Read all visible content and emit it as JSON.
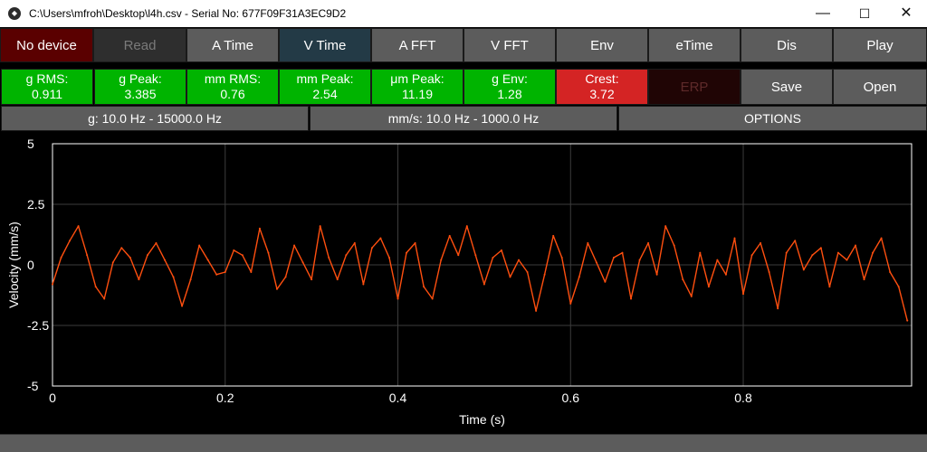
{
  "window": {
    "title": "C:\\Users\\mfroh\\Desktop\\l4h.csv - Serial No: 677F09F31A3EC9D2",
    "icon": "app-logo-icon",
    "minimize": "—",
    "maximize": "☐",
    "close": "✕"
  },
  "toolbar": {
    "no_device": "No device",
    "read": "Read",
    "a_time": "A Time",
    "v_time": "V Time",
    "a_fft": "A FFT",
    "v_fft": "V FFT",
    "env": "Env",
    "etime": "eTime",
    "dis": "Dis",
    "play": "Play"
  },
  "metrics": [
    {
      "label": "g RMS:",
      "value": "0.911"
    },
    {
      "label": "g Peak:",
      "value": "3.385"
    },
    {
      "label": "mm RMS:",
      "value": "0.76"
    },
    {
      "label": "mm Peak:",
      "value": "2.54"
    },
    {
      "label": "μm Peak:",
      "value": "11.19"
    },
    {
      "label": "g Env:",
      "value": "1.28"
    },
    {
      "label": "Crest:",
      "value": "3.72"
    }
  ],
  "actions": {
    "erp": "ERP",
    "save": "Save",
    "open": "Open"
  },
  "filters": {
    "g_range": "g: 10.0 Hz - 15000.0 Hz",
    "mm_range": "mm/s: 10.0 Hz - 1000.0 Hz",
    "options": "OPTIONS"
  },
  "colors": {
    "trace": "#ff4f0f",
    "grid": "#3c3c3c",
    "axes_frame": "#ffffff",
    "ok": "#00b400",
    "alarm": "#d42424"
  },
  "chart_data": {
    "type": "line",
    "xlabel": "Time (s)",
    "ylabel": "Velocity (mm/s)",
    "xlim": [
      0,
      0.995
    ],
    "ylim": [
      -5,
      5
    ],
    "x_ticks": [
      "0",
      "0.2",
      "0.4",
      "0.6",
      "0.8"
    ],
    "y_ticks": [
      "5",
      "2.5",
      "0",
      "-2.5",
      "-5"
    ],
    "x_tick_values": [
      0,
      0.2,
      0.4,
      0.6,
      0.8
    ],
    "y_tick_values": [
      5,
      2.5,
      0,
      -2.5,
      -5
    ],
    "grid": true,
    "series": [
      {
        "x": [
          0,
          0.01,
          0.02,
          0.03,
          0.04,
          0.05,
          0.06,
          0.07,
          0.08,
          0.09,
          0.1,
          0.11,
          0.12,
          0.13,
          0.14,
          0.15,
          0.16,
          0.17,
          0.18,
          0.19,
          0.2,
          0.21,
          0.22,
          0.23,
          0.24,
          0.25,
          0.26,
          0.27,
          0.28,
          0.29,
          0.3,
          0.31,
          0.32,
          0.33,
          0.34,
          0.35,
          0.36,
          0.37,
          0.38,
          0.39,
          0.4,
          0.41,
          0.42,
          0.43,
          0.44,
          0.45,
          0.46,
          0.47,
          0.48,
          0.49,
          0.5,
          0.51,
          0.52,
          0.53,
          0.54,
          0.55,
          0.56,
          0.57,
          0.58,
          0.59,
          0.6,
          0.61,
          0.62,
          0.63,
          0.64,
          0.65,
          0.66,
          0.67,
          0.68,
          0.69,
          0.7,
          0.71,
          0.72,
          0.73,
          0.74,
          0.75,
          0.76,
          0.77,
          0.78,
          0.79,
          0.8,
          0.81,
          0.82,
          0.83,
          0.84,
          0.85,
          0.86,
          0.87,
          0.88,
          0.89,
          0.9,
          0.91,
          0.92,
          0.93,
          0.94,
          0.95,
          0.96,
          0.97,
          0.98,
          0.99
        ],
        "y": [
          -0.8,
          0.3,
          1.0,
          1.6,
          0.4,
          -0.9,
          -1.4,
          0.1,
          0.7,
          0.3,
          -0.6,
          0.4,
          0.9,
          0.2,
          -0.5,
          -1.7,
          -0.6,
          0.8,
          0.2,
          -0.4,
          -0.3,
          0.6,
          0.4,
          -0.3,
          1.5,
          0.5,
          -1.0,
          -0.5,
          0.8,
          0.1,
          -0.6,
          1.6,
          0.3,
          -0.6,
          0.4,
          0.9,
          -0.8,
          0.7,
          1.1,
          0.3,
          -1.4,
          0.5,
          0.9,
          -0.9,
          -1.4,
          0.2,
          1.2,
          0.4,
          1.6,
          0.4,
          -0.8,
          0.3,
          0.6,
          -0.5,
          0.2,
          -0.3,
          -1.9,
          -0.4,
          1.2,
          0.3,
          -1.6,
          -0.5,
          0.9,
          0.1,
          -0.7,
          0.3,
          0.5,
          -1.4,
          0.2,
          0.9,
          -0.4,
          1.6,
          0.8,
          -0.6,
          -1.3,
          0.5,
          -0.9,
          0.2,
          -0.4,
          1.1,
          -1.2,
          0.4,
          0.9,
          -0.3,
          -1.8,
          0.5,
          1.0,
          -0.2,
          0.4,
          0.7,
          -0.9,
          0.5,
          0.2,
          0.8,
          -0.6,
          0.5,
          1.1,
          -0.3,
          -0.9,
          -2.3
        ]
      }
    ]
  }
}
